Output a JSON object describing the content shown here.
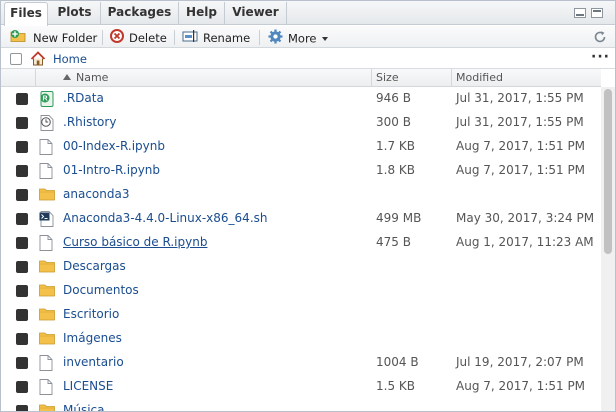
{
  "tabs": [
    {
      "label": "Files",
      "active": true
    },
    {
      "label": "Plots",
      "active": false
    },
    {
      "label": "Packages",
      "active": false
    },
    {
      "label": "Help",
      "active": false
    },
    {
      "label": "Viewer",
      "active": false
    }
  ],
  "toolbar": {
    "new_folder": "New Folder",
    "delete": "Delete",
    "rename": "Rename",
    "more": "More"
  },
  "path": {
    "home": "Home"
  },
  "columns": {
    "name": "Name",
    "size": "Size",
    "modified": "Modified"
  },
  "files": [
    {
      "name": ".RData",
      "size": "946 B",
      "modified": "Jul 31, 2017, 1:55 PM",
      "icon": "rdata-icon",
      "underlined": false
    },
    {
      "name": ".Rhistory",
      "size": "300 B",
      "modified": "Jul 31, 2017, 1:55 PM",
      "icon": "history-icon",
      "underlined": false
    },
    {
      "name": "00-Index-R.ipynb",
      "size": "1.7 KB",
      "modified": "Aug 7, 2017, 1:51 PM",
      "icon": "file-icon",
      "underlined": false
    },
    {
      "name": "01-Intro-R.ipynb",
      "size": "1.8 KB",
      "modified": "Aug 7, 2017, 1:51 PM",
      "icon": "file-icon",
      "underlined": false
    },
    {
      "name": "anaconda3",
      "size": "",
      "modified": "",
      "icon": "folder-icon",
      "underlined": false
    },
    {
      "name": "Anaconda3-4.4.0-Linux-x86_64.sh",
      "size": "499 MB",
      "modified": "May 30, 2017, 3:24 PM",
      "icon": "shell-script-icon",
      "underlined": false
    },
    {
      "name": "Curso básico de R.ipynb",
      "size": "475 B",
      "modified": "Aug 1, 2017, 11:23 AM",
      "icon": "file-icon",
      "underlined": true
    },
    {
      "name": "Descargas",
      "size": "",
      "modified": "",
      "icon": "folder-icon",
      "underlined": false
    },
    {
      "name": "Documentos",
      "size": "",
      "modified": "",
      "icon": "folder-icon",
      "underlined": false
    },
    {
      "name": "Escritorio",
      "size": "",
      "modified": "",
      "icon": "folder-icon",
      "underlined": false
    },
    {
      "name": "Imágenes",
      "size": "",
      "modified": "",
      "icon": "folder-icon",
      "underlined": false
    },
    {
      "name": "inventario",
      "size": "1004 B",
      "modified": "Jul 19, 2017, 2:07 PM",
      "icon": "file-icon",
      "underlined": false
    },
    {
      "name": "LICENSE",
      "size": "1.5 KB",
      "modified": "Aug 7, 2017, 1:51 PM",
      "icon": "file-icon",
      "underlined": false
    },
    {
      "name": "Música",
      "size": "",
      "modified": "",
      "icon": "folder-icon",
      "underlined": false
    }
  ],
  "colors": {
    "link": "#1a4d8f",
    "folder": "#f3c14a",
    "accent_green": "#2e9b57",
    "delete_red": "#c0392b"
  }
}
